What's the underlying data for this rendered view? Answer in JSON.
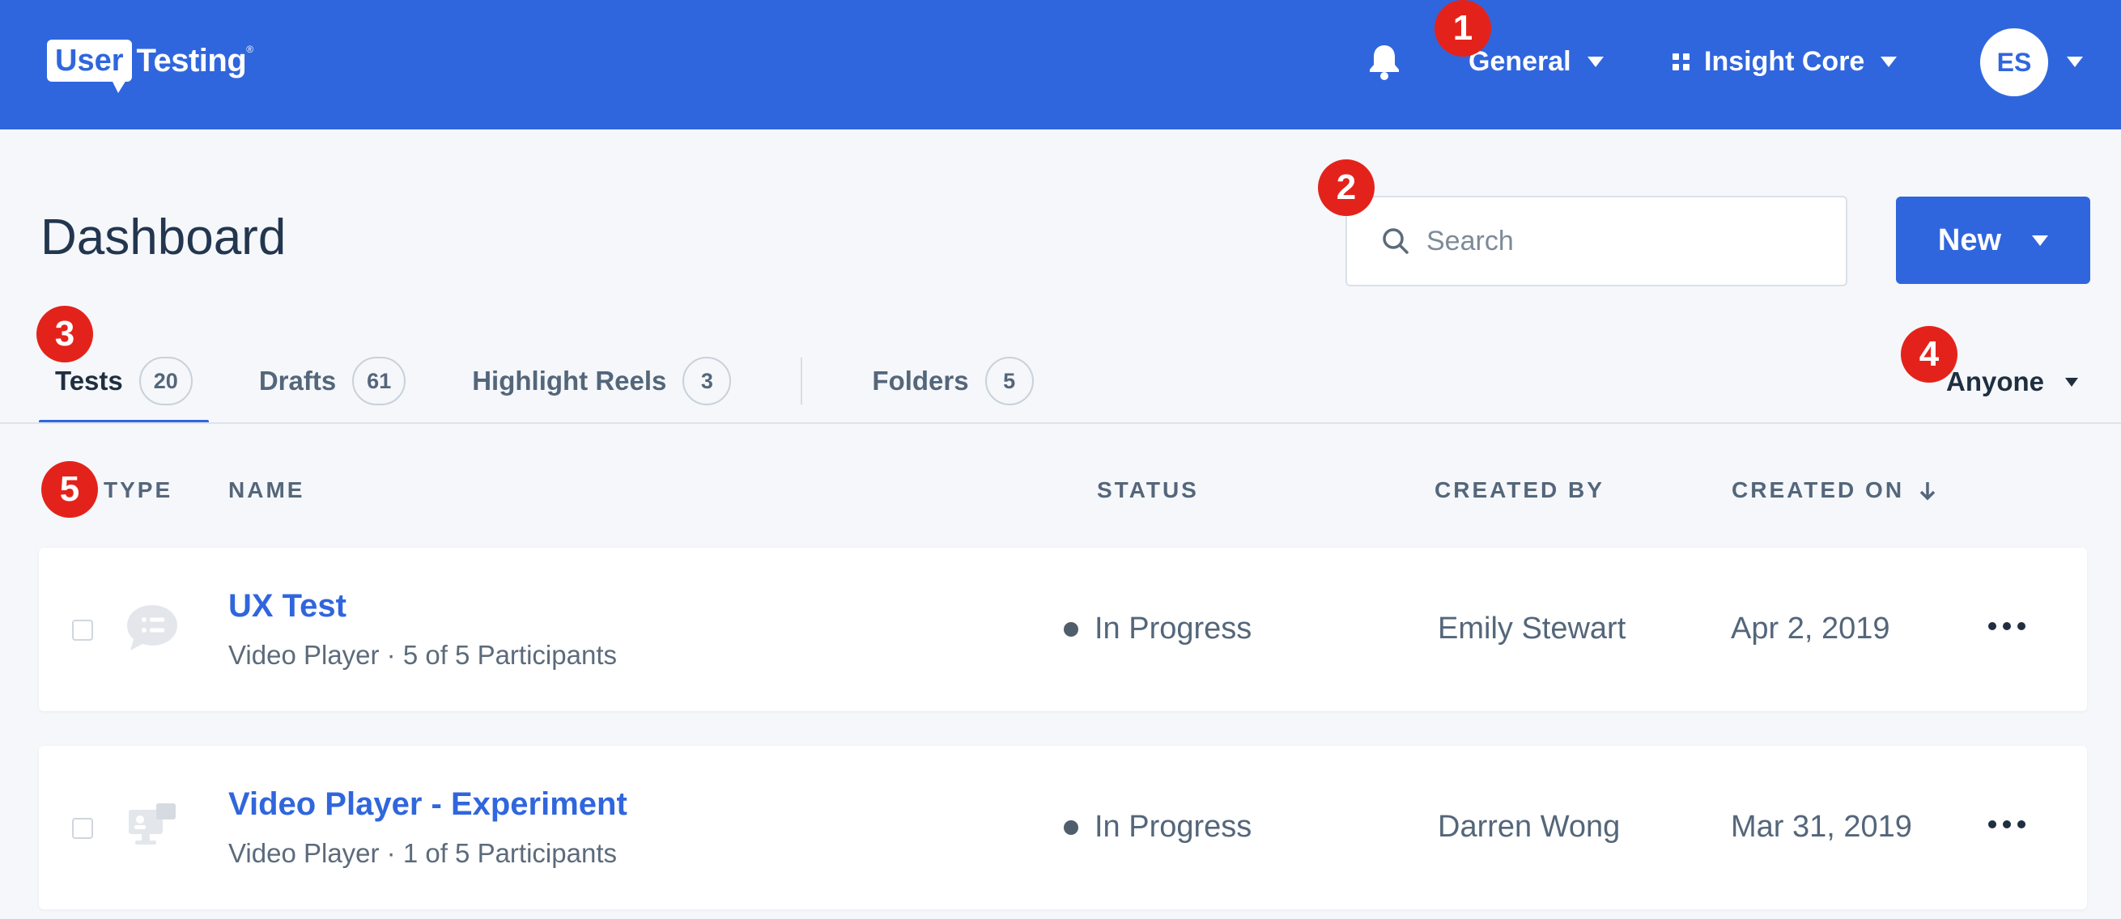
{
  "app": {
    "logo_box": "User",
    "logo_text": "Testing",
    "logo_tm": "®"
  },
  "topnav": {
    "workspace_label": "General",
    "product_label": "Insight Core",
    "avatar_initials": "ES"
  },
  "markers": [
    "1",
    "2",
    "3",
    "4",
    "5"
  ],
  "header": {
    "title": "Dashboard",
    "search_placeholder": "Search",
    "new_label": "New"
  },
  "tabs": [
    {
      "label": "Tests",
      "count": "20"
    },
    {
      "label": "Drafts",
      "count": "61"
    },
    {
      "label": "Highlight Reels",
      "count": "3"
    },
    {
      "label": "Folders",
      "count": "5"
    }
  ],
  "filter": {
    "owner_label": "Anyone"
  },
  "table": {
    "columns": [
      "TYPE",
      "NAME",
      "STATUS",
      "CREATED BY",
      "CREATED ON"
    ],
    "sorted_column": "CREATED ON",
    "rows": [
      {
        "type_icon": "chat-list-icon",
        "name": "UX Test",
        "subtitle": "Video Player · 5 of 5 Participants",
        "status": "In Progress",
        "created_by": "Emily Stewart",
        "created_on": "Apr 2, 2019"
      },
      {
        "type_icon": "desktop-experiment-icon",
        "name": "Video Player - Experiment",
        "subtitle": "Video Player · 1 of 5 Participants",
        "status": "In Progress",
        "created_by": "Darren Wong",
        "created_on": "Mar 31, 2019"
      }
    ]
  },
  "colors": {
    "brand_blue": "#3066dd",
    "marker_red": "#e3231b",
    "background": "#f5f7fa"
  }
}
